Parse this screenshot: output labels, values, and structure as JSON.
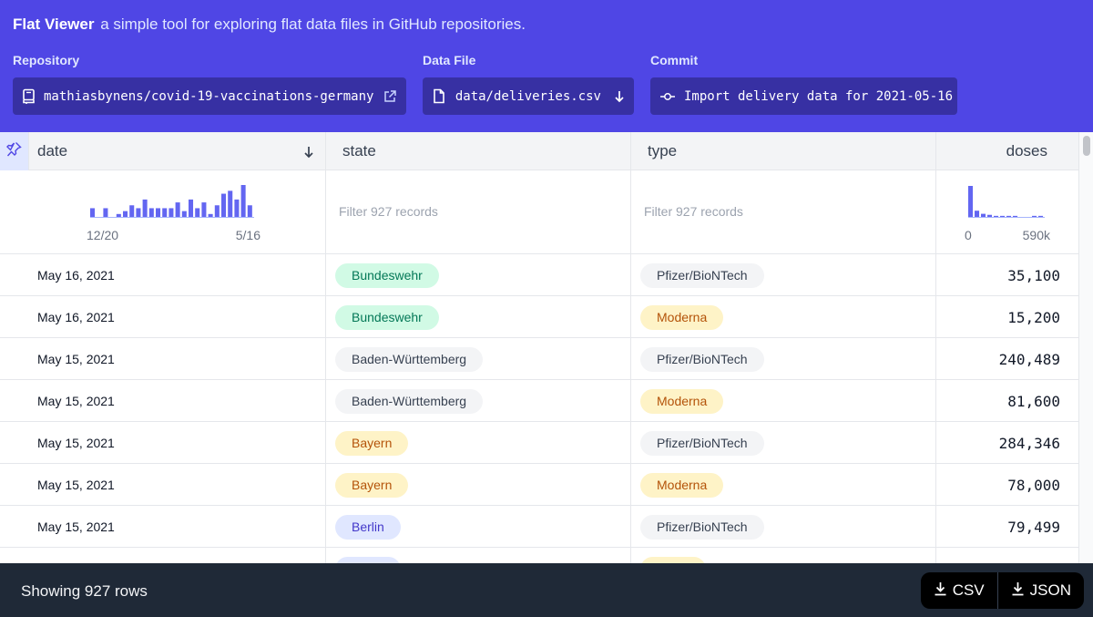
{
  "header": {
    "app_name": "Flat Viewer",
    "tagline": "a simple tool for exploring flat data files in GitHub repositories.",
    "repository": {
      "label": "Repository",
      "value": "mathiasbynens/covid-19-vaccinations-germany",
      "icon": "repo-icon",
      "action_icon": "external-link-icon"
    },
    "data_file": {
      "label": "Data File",
      "value": "data/deliveries.csv",
      "icon": "file-icon",
      "action_icon": "arrow-down-icon"
    },
    "commit": {
      "label": "Commit",
      "value": "Import delivery data for 2021-05-16",
      "icon": "commit-icon"
    }
  },
  "colors": {
    "header_bg": "#4f46e5",
    "picker_bg": "#3730a3",
    "bar": "#6366f1",
    "footer_bg": "#1f2937"
  },
  "table": {
    "columns": [
      {
        "label": "date",
        "sort_icon": "arrow-down-icon",
        "sorted": "descending"
      },
      {
        "label": "state"
      },
      {
        "label": "type"
      },
      {
        "label": "doses"
      }
    ],
    "pin_icon": "pin-icon",
    "filters": {
      "state_placeholder": "Filter 927 records",
      "type_placeholder": "Filter 927 records"
    },
    "date_histogram": {
      "start_label": "12/20",
      "end_label": "5/16",
      "values": [
        3,
        0,
        3,
        0,
        1,
        2,
        4,
        3,
        6,
        3,
        3,
        3,
        3,
        5,
        2,
        6,
        3,
        5,
        1,
        4,
        8,
        9,
        6,
        11,
        4
      ]
    },
    "doses_histogram": {
      "min_label": "0",
      "max_label": "590k",
      "values": [
        30,
        6,
        3,
        2,
        1,
        1,
        1,
        1,
        0,
        0,
        1,
        1
      ]
    },
    "rows": [
      {
        "date": "May 16, 2021",
        "state": "Bundeswehr",
        "state_tone": "green",
        "type": "Pfizer/BioNTech",
        "type_tone": "gray",
        "doses": "35,100"
      },
      {
        "date": "May 16, 2021",
        "state": "Bundeswehr",
        "state_tone": "green",
        "type": "Moderna",
        "type_tone": "yellow",
        "doses": "15,200"
      },
      {
        "date": "May 15, 2021",
        "state": "Baden-Württemberg",
        "state_tone": "gray",
        "type": "Pfizer/BioNTech",
        "type_tone": "gray",
        "doses": "240,489"
      },
      {
        "date": "May 15, 2021",
        "state": "Baden-Württemberg",
        "state_tone": "gray",
        "type": "Moderna",
        "type_tone": "yellow",
        "doses": "81,600"
      },
      {
        "date": "May 15, 2021",
        "state": "Bayern",
        "state_tone": "yellow",
        "type": "Pfizer/BioNTech",
        "type_tone": "gray",
        "doses": "284,346"
      },
      {
        "date": "May 15, 2021",
        "state": "Bayern",
        "state_tone": "yellow",
        "type": "Moderna",
        "type_tone": "yellow",
        "doses": "78,000"
      },
      {
        "date": "May 15, 2021",
        "state": "Berlin",
        "state_tone": "indigo",
        "type": "Pfizer/BioNTech",
        "type_tone": "gray",
        "doses": "79,499"
      },
      {
        "date": "",
        "state": "",
        "state_tone": "indigo",
        "type": "",
        "type_tone": "yellow",
        "doses": ""
      }
    ]
  },
  "footer": {
    "row_count": "Showing 927 rows",
    "csv_label": "CSV",
    "json_label": "JSON",
    "download_icon": "download-icon"
  }
}
